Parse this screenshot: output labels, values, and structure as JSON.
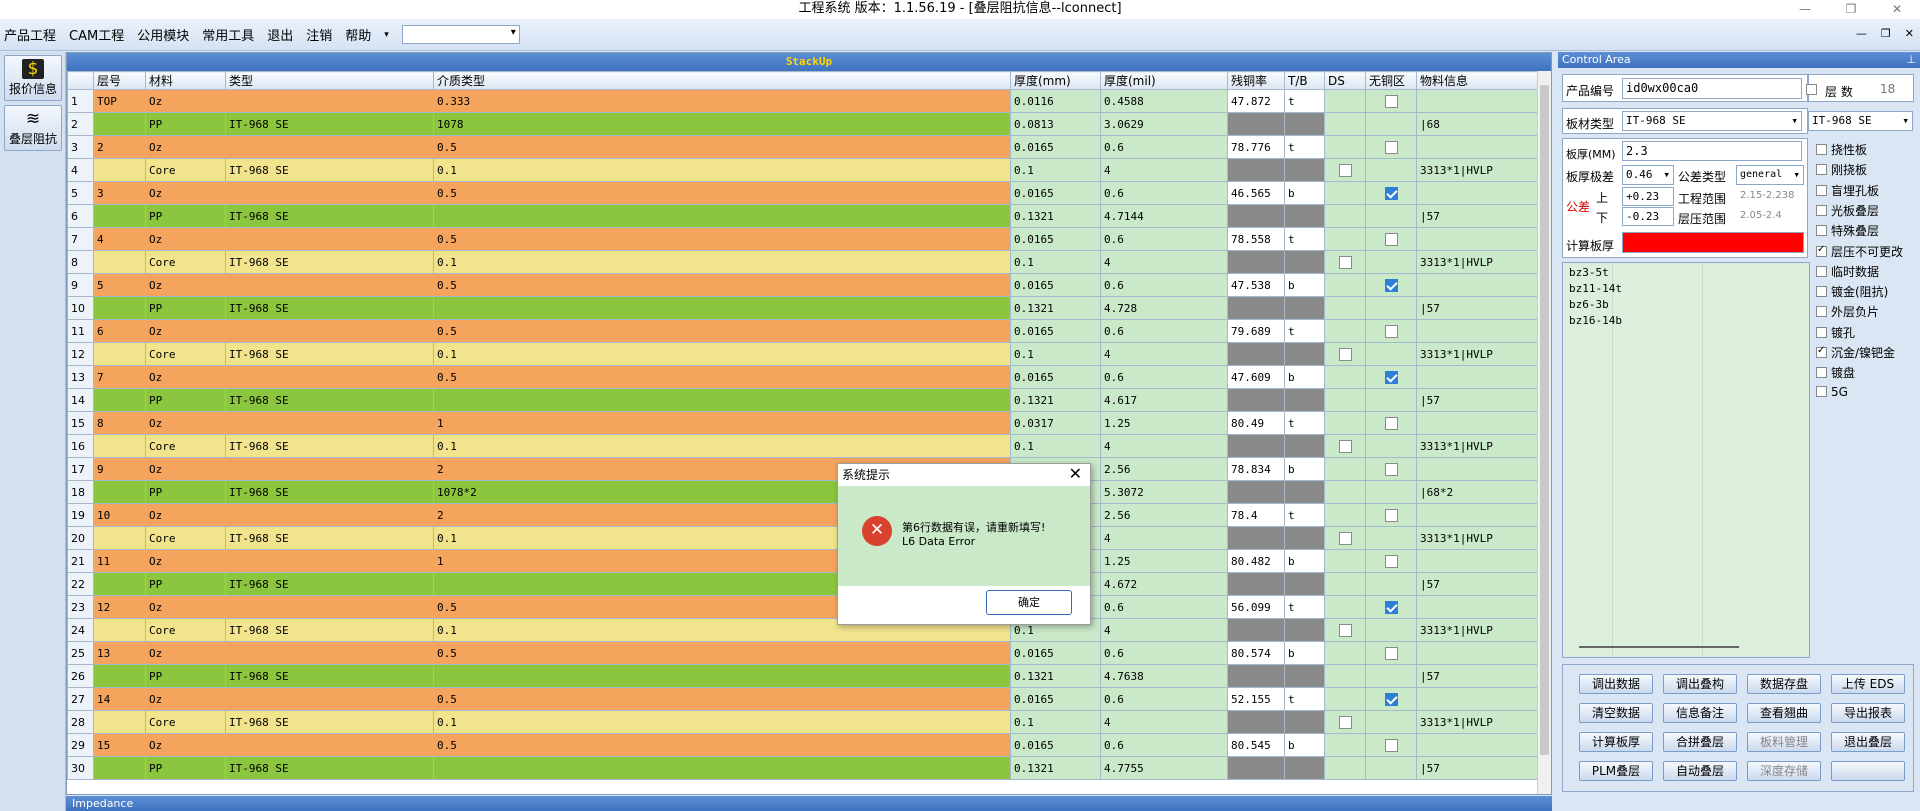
{
  "window": {
    "title": "工程系统   版本：1.1.56.19 - [叠层阻抗信息--lconnect]"
  },
  "menu": [
    "产品工程",
    "CAM工程",
    "公用模块",
    "常用工具",
    "退出",
    "注销",
    "帮助"
  ],
  "left_buttons": [
    {
      "label": "报价信息",
      "icon": "dollar-icon"
    },
    {
      "label": "叠层阻抗",
      "icon": "layers-icon"
    }
  ],
  "grid": {
    "title": "StackUp",
    "columns": [
      "",
      "层号",
      "材料",
      "类型",
      "介质类型",
      "厚度(mm)",
      "厚度(mil)",
      "残铜率",
      "T/B",
      "DS",
      "无铜区",
      "物料信息"
    ],
    "rows": [
      {
        "n": "1",
        "type": "cu",
        "layer": "TOP",
        "mat": "Oz",
        "kind": "",
        "diel": "0.333",
        "mm": "0.0116",
        "mil": "0.4588",
        "res": "47.872",
        "tb": "t",
        "ds": "",
        "nocu": "off",
        "info": ""
      },
      {
        "n": "2",
        "type": "pp",
        "layer": "",
        "mat": "PP",
        "kind": "IT-968 SE",
        "diel": "1078",
        "mm": "0.0813",
        "mil": "3.0629",
        "res": "",
        "tb": "",
        "ds": "",
        "nocu": "",
        "info": "|68"
      },
      {
        "n": "3",
        "type": "cu",
        "layer": "2",
        "mat": "Oz",
        "kind": "",
        "diel": "0.5",
        "mm": "0.0165",
        "mil": "0.6",
        "res": "78.776",
        "tb": "t",
        "ds": "",
        "nocu": "off",
        "info": ""
      },
      {
        "n": "4",
        "type": "ct",
        "layer": "",
        "mat": "Core",
        "kind": "IT-968 SE",
        "diel": "0.1",
        "mm": "0.1",
        "mil": "4",
        "res": "",
        "tb": "",
        "ds": "off",
        "nocu": "",
        "info": "3313*1|HVLP"
      },
      {
        "n": "5",
        "type": "cu",
        "layer": "3",
        "mat": "Oz",
        "kind": "",
        "diel": "0.5",
        "mm": "0.0165",
        "mil": "0.6",
        "res": "46.565",
        "tb": "b",
        "ds": "",
        "nocu": "on",
        "info": ""
      },
      {
        "n": "6",
        "type": "pp",
        "layer": "",
        "mat": "PP",
        "kind": "IT-968 SE",
        "diel": "",
        "mm": "0.1321",
        "mil": "4.7144",
        "res": "",
        "tb": "",
        "ds": "",
        "nocu": "",
        "info": "|57"
      },
      {
        "n": "7",
        "type": "cu",
        "layer": "4",
        "mat": "Oz",
        "kind": "",
        "diel": "0.5",
        "mm": "0.0165",
        "mil": "0.6",
        "res": "78.558",
        "tb": "t",
        "ds": "",
        "nocu": "off",
        "info": ""
      },
      {
        "n": "8",
        "type": "ct",
        "layer": "",
        "mat": "Core",
        "kind": "IT-968 SE",
        "diel": "0.1",
        "mm": "0.1",
        "mil": "4",
        "res": "",
        "tb": "",
        "ds": "off",
        "nocu": "",
        "info": "3313*1|HVLP"
      },
      {
        "n": "9",
        "type": "cu",
        "layer": "5",
        "mat": "Oz",
        "kind": "",
        "diel": "0.5",
        "mm": "0.0165",
        "mil": "0.6",
        "res": "47.538",
        "tb": "b",
        "ds": "",
        "nocu": "on",
        "info": ""
      },
      {
        "n": "10",
        "type": "pp",
        "layer": "",
        "mat": "PP",
        "kind": "IT-968 SE",
        "diel": "",
        "mm": "0.1321",
        "mil": "4.728",
        "res": "",
        "tb": "",
        "ds": "",
        "nocu": "",
        "info": "|57"
      },
      {
        "n": "11",
        "type": "cu",
        "layer": "6",
        "mat": "Oz",
        "kind": "",
        "diel": "0.5",
        "mm": "0.0165",
        "mil": "0.6",
        "res": "79.689",
        "tb": "t",
        "ds": "",
        "nocu": "off",
        "info": ""
      },
      {
        "n": "12",
        "type": "ct",
        "layer": "",
        "mat": "Core",
        "kind": "IT-968 SE",
        "diel": "0.1",
        "mm": "0.1",
        "mil": "4",
        "res": "",
        "tb": "",
        "ds": "off",
        "nocu": "",
        "info": "3313*1|HVLP"
      },
      {
        "n": "13",
        "type": "cu",
        "layer": "7",
        "mat": "Oz",
        "kind": "",
        "diel": "0.5",
        "mm": "0.0165",
        "mil": "0.6",
        "res": "47.609",
        "tb": "b",
        "ds": "",
        "nocu": "on",
        "info": ""
      },
      {
        "n": "14",
        "type": "pp",
        "layer": "",
        "mat": "PP",
        "kind": "IT-968 SE",
        "diel": "",
        "mm": "0.1321",
        "mil": "4.617",
        "res": "",
        "tb": "",
        "ds": "",
        "nocu": "",
        "info": "|57"
      },
      {
        "n": "15",
        "type": "cu",
        "layer": "8",
        "mat": "Oz",
        "kind": "",
        "diel": "1",
        "mm": "0.0317",
        "mil": "1.25",
        "res": "80.49",
        "tb": "t",
        "ds": "",
        "nocu": "off",
        "info": ""
      },
      {
        "n": "16",
        "type": "ct",
        "layer": "",
        "mat": "Core",
        "kind": "IT-968 SE",
        "diel": "0.1",
        "mm": "0.1",
        "mil": "4",
        "res": "",
        "tb": "",
        "ds": "off",
        "nocu": "",
        "info": "3313*1|HVLP"
      },
      {
        "n": "17",
        "type": "cu",
        "layer": "9",
        "mat": "Oz",
        "kind": "",
        "diel": "2",
        "mm": "",
        "mil": "2.56",
        "res": "78.834",
        "tb": "b",
        "ds": "",
        "nocu": "off",
        "info": ""
      },
      {
        "n": "18",
        "type": "pp",
        "layer": "",
        "mat": "PP",
        "kind": "IT-968 SE",
        "diel": "1078*2",
        "mm": "",
        "mil": "5.3072",
        "res": "",
        "tb": "",
        "ds": "",
        "nocu": "",
        "info": "|68*2"
      },
      {
        "n": "19",
        "type": "cu",
        "layer": "10",
        "mat": "Oz",
        "kind": "",
        "diel": "2",
        "mm": "",
        "mil": "2.56",
        "res": "78.4",
        "tb": "t",
        "ds": "",
        "nocu": "off",
        "info": ""
      },
      {
        "n": "20",
        "type": "ct",
        "layer": "",
        "mat": "Core",
        "kind": "IT-968 SE",
        "diel": "0.1",
        "mm": "",
        "mil": "4",
        "res": "",
        "tb": "",
        "ds": "off",
        "nocu": "",
        "info": "3313*1|HVLP"
      },
      {
        "n": "21",
        "type": "cu",
        "layer": "11",
        "mat": "Oz",
        "kind": "",
        "diel": "1",
        "mm": "",
        "mil": "1.25",
        "res": "80.482",
        "tb": "b",
        "ds": "",
        "nocu": "off",
        "info": ""
      },
      {
        "n": "22",
        "type": "pp",
        "layer": "",
        "mat": "PP",
        "kind": "IT-968 SE",
        "diel": "",
        "mm": "",
        "mil": "4.672",
        "res": "",
        "tb": "",
        "ds": "",
        "nocu": "",
        "info": "|57"
      },
      {
        "n": "23",
        "type": "cu",
        "layer": "12",
        "mat": "Oz",
        "kind": "",
        "diel": "0.5",
        "mm": "",
        "mil": "0.6",
        "res": "56.099",
        "tb": "t",
        "ds": "",
        "nocu": "on",
        "info": ""
      },
      {
        "n": "24",
        "type": "ct",
        "layer": "",
        "mat": "Core",
        "kind": "IT-968 SE",
        "diel": "0.1",
        "mm": "0.1",
        "mil": "4",
        "res": "",
        "tb": "",
        "ds": "off",
        "nocu": "",
        "info": "3313*1|HVLP"
      },
      {
        "n": "25",
        "type": "cu",
        "layer": "13",
        "mat": "Oz",
        "kind": "",
        "diel": "0.5",
        "mm": "0.0165",
        "mil": "0.6",
        "res": "80.574",
        "tb": "b",
        "ds": "",
        "nocu": "off",
        "info": ""
      },
      {
        "n": "26",
        "type": "pp",
        "layer": "",
        "mat": "PP",
        "kind": "IT-968 SE",
        "diel": "",
        "mm": "0.1321",
        "mil": "4.7638",
        "res": "",
        "tb": "",
        "ds": "",
        "nocu": "",
        "info": "|57"
      },
      {
        "n": "27",
        "type": "cu",
        "layer": "14",
        "mat": "Oz",
        "kind": "",
        "diel": "0.5",
        "mm": "0.0165",
        "mil": "0.6",
        "res": "52.155",
        "tb": "t",
        "ds": "",
        "nocu": "on",
        "info": ""
      },
      {
        "n": "28",
        "type": "ct",
        "layer": "",
        "mat": "Core",
        "kind": "IT-968 SE",
        "diel": "0.1",
        "mm": "0.1",
        "mil": "4",
        "res": "",
        "tb": "",
        "ds": "off",
        "nocu": "",
        "info": "3313*1|HVLP"
      },
      {
        "n": "29",
        "type": "cu",
        "layer": "15",
        "mat": "Oz",
        "kind": "",
        "diel": "0.5",
        "mm": "0.0165",
        "mil": "0.6",
        "res": "80.545",
        "tb": "b",
        "ds": "",
        "nocu": "off",
        "info": ""
      },
      {
        "n": "30",
        "type": "pp",
        "layer": "",
        "mat": "PP",
        "kind": "IT-968 SE",
        "diel": "",
        "mm": "0.1321",
        "mil": "4.7755",
        "res": "",
        "tb": "",
        "ds": "",
        "nocu": "",
        "info": "|57"
      }
    ]
  },
  "impedance_bar": "Impedance",
  "control": {
    "title": "Control Area",
    "product_no_label": "产品编号",
    "product_no": "id0wx00ca0",
    "layers_label": "层 数",
    "layers": "18",
    "board_type_label": "板材类型",
    "board_type": "IT-968 SE",
    "board_type2": "IT-968 SE",
    "thickness_label": "板厚(MM)",
    "thickness": "2.3",
    "tol_label": "板厚极差",
    "tol": "0.46",
    "tol_type_label": "公差类型",
    "tol_type": "general",
    "tol_side_label": "公差",
    "up_label": "上",
    "up": "+0.23",
    "down_label": "下",
    "down": "-0.23",
    "eng_range_label": "工程范围",
    "eng_range": "2.15-2.238",
    "press_range_label": "层压范围",
    "press_range": "2.05-2.4",
    "calc_label": "计算板厚",
    "list": [
      "bz3-5t",
      "bz11-14t",
      "bz6-3b",
      "bz16-14b"
    ],
    "options": [
      {
        "label": "挠性板",
        "checked": false
      },
      {
        "label": "刚挠板",
        "checked": false
      },
      {
        "label": "盲埋孔板",
        "checked": false
      },
      {
        "label": "光板叠层",
        "checked": false
      },
      {
        "label": "特殊叠层",
        "checked": false
      },
      {
        "label": "层压不可更改",
        "checked": true
      },
      {
        "label": "临时数据",
        "checked": false
      },
      {
        "label": "镀金(阻抗)",
        "checked": false
      },
      {
        "label": "外层负片",
        "checked": false
      },
      {
        "label": "镀孔",
        "checked": false
      },
      {
        "label": "沉金/镍钯金",
        "checked": true
      },
      {
        "label": "镀盘",
        "checked": false
      },
      {
        "label": "5G",
        "checked": false
      }
    ],
    "buttons": [
      {
        "label": "调出数据",
        "disabled": false
      },
      {
        "label": "调出叠构",
        "disabled": false
      },
      {
        "label": "数据存盘",
        "disabled": false
      },
      {
        "label": "上传 EDS",
        "disabled": false
      },
      {
        "label": "清空数据",
        "disabled": false
      },
      {
        "label": "信息备注",
        "disabled": false
      },
      {
        "label": "查看翘曲",
        "disabled": false
      },
      {
        "label": "导出报表",
        "disabled": false
      },
      {
        "label": "计算板厚",
        "disabled": false
      },
      {
        "label": "合拼叠层",
        "disabled": false
      },
      {
        "label": "板料管理",
        "disabled": true
      },
      {
        "label": "退出叠层",
        "disabled": false
      },
      {
        "label": "PLM叠层",
        "disabled": false
      },
      {
        "label": "自动叠层",
        "disabled": false
      },
      {
        "label": "深度存储",
        "disabled": true
      },
      {
        "label": "",
        "disabled": false
      }
    ]
  },
  "dialog": {
    "title": "系统提示",
    "message1": "第6行数据有误，请重新填写!",
    "message2": "L6 Data Error",
    "ok": "确定"
  },
  "colors": {
    "copper": "#f4a45c",
    "prepreg": "#8cc63f",
    "core": "#f1e48c",
    "cell": "#c9e9c9",
    "error": "#ff0000"
  }
}
